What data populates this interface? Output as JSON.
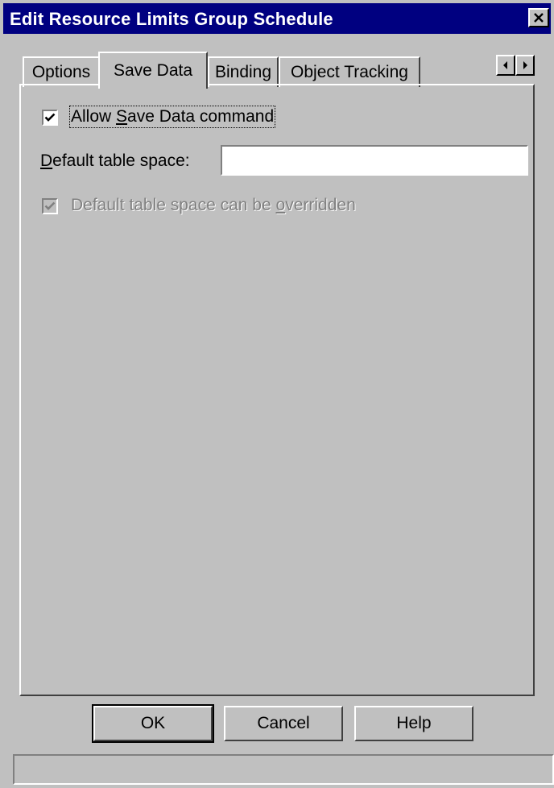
{
  "window": {
    "title": "Edit Resource Limits Group Schedule",
    "title_bar_color": "#000080",
    "face_color": "#c0c0c0"
  },
  "tabs": [
    {
      "label": "Options",
      "active": false
    },
    {
      "label": "Save Data",
      "active": true
    },
    {
      "label": "Binding",
      "active": false
    },
    {
      "label": "Object Tracking",
      "active": false
    }
  ],
  "save_data": {
    "allow_save": {
      "label_pre": "Allow ",
      "label_mnemonic": "S",
      "label_post": "ave Data command",
      "checked": true
    },
    "default_table_space": {
      "label_mnemonic": "D",
      "label_post": "efault table space:",
      "value": ""
    },
    "can_be_overridden": {
      "label_pre": "Default table space can be ",
      "label_mnemonic": "o",
      "label_post": "verridden",
      "checked": true,
      "disabled": true
    }
  },
  "buttons": {
    "ok": "OK",
    "cancel": "Cancel",
    "help": "Help"
  },
  "status_text": "",
  "icons": {
    "close": "close-icon",
    "scroll_left": "arrow-left-icon",
    "scroll_right": "arrow-right-icon",
    "check": "checkmark-icon"
  }
}
